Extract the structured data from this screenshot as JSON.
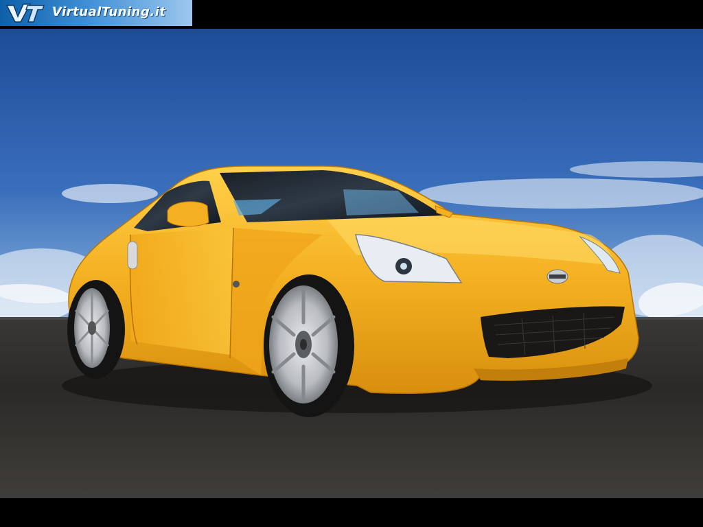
{
  "watermark": {
    "text": "VirtualTuning.it",
    "logo_letters": "VT",
    "gradient_colors": [
      "#0d5fa8",
      "#3f8fd6",
      "#9cc7ee"
    ]
  },
  "scene": {
    "sky_colors": [
      "#1f4f9e",
      "#3e74bd",
      "#6c9fd4"
    ],
    "road_color": "#2f2d2b",
    "car_color": "#f5b324"
  }
}
